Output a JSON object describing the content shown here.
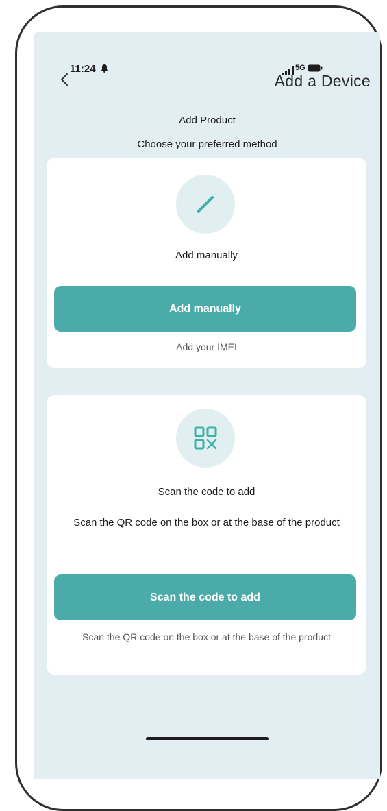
{
  "status_bar": {
    "time": "11:24",
    "network": "5G"
  },
  "header": {
    "title": "Add a Device"
  },
  "page": {
    "heading": "Add Product",
    "subheading": "Choose your preferred method"
  },
  "manual_card": {
    "icon": "pencil-icon",
    "title": "Add manually",
    "button_label": "Add manually",
    "helper_text": "Add your IMEI"
  },
  "scan_card": {
    "icon": "qr-code-icon",
    "title": "Scan the code to add",
    "description": "Scan the QR code on the box or at the base of the product",
    "button_label": "Scan the code to add",
    "helper_text": "Scan the QR code on the box or at the base of the product"
  },
  "colors": {
    "accent": "#4aaba8",
    "background": "#e3eef3",
    "icon_circle": "#e1eff0"
  }
}
